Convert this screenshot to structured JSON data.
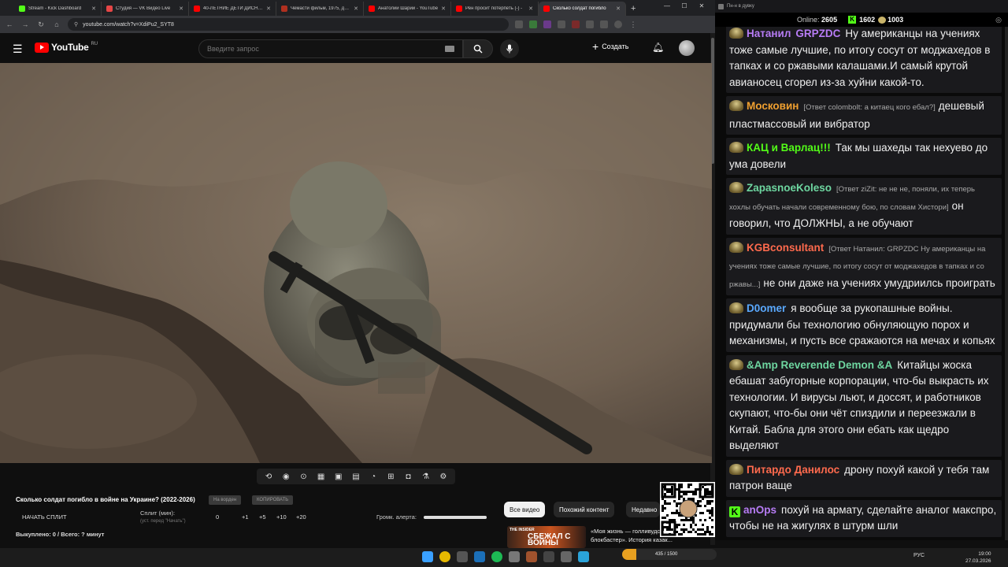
{
  "browser": {
    "tabs": [
      {
        "title": "Stream - Kick Dashboard",
        "color": "#53fc18"
      },
      {
        "title": "Студия — VK Видео Live",
        "color": "#e64646"
      },
      {
        "title": "40-ЛЕТНИЕ ДЕТИ ДИСНЕЯ",
        "color": "#ff0000"
      },
      {
        "title": "Чемасти фильм, 1975, дата",
        "color": "#b0301f"
      },
      {
        "title": "Анатолий Шарий - YouTube",
        "color": "#ff0000"
      },
      {
        "title": "Рен просит потерпеть (-) -",
        "color": "#ff0000"
      },
      {
        "title": "Сколько солдат погибло",
        "color": "#ff0000"
      }
    ],
    "new_tab": "+",
    "url": "youtube.com/watch?v=XdiPu2_SYT8"
  },
  "youtube": {
    "logo_text": "YouTube",
    "region": "RU",
    "search_placeholder": "Введите запрос",
    "create_label": "Создать",
    "video_title": "Сколько солдат погибло в войне на Украине? (2022-2026)",
    "chip_1": "На ворден",
    "chip_2": "КОПИРОВАТЬ",
    "split_button": "НАЧАТЬ СПЛИТ",
    "split_label": "Сплит (мин):",
    "split_sub": "(уст. перед \"Начать\")",
    "split_values": [
      "0",
      "+1",
      "+5",
      "+10",
      "+20"
    ],
    "alert_label": "Громк. алерта:",
    "alert_volume": 1.0,
    "footer_stat": "Выкуплено: 0 / Всего: ? минут",
    "filter_chips": [
      "Все видео",
      "Похожий контент",
      "Недавно"
    ],
    "rec_thumb_top": "THE INSIDER",
    "rec_thumb_text": "СБЕЖАЛ С ВОЙНЫ",
    "rec_title": "«Моя жизнь — голливудский блокбастер». История казак..."
  },
  "chat": {
    "header": "Пн-н в дувку",
    "online_label": "Online:",
    "online_count": "2605",
    "kick_count": "1602",
    "other_count": "1003",
    "messages": [
      {
        "nick": "Натанил",
        "nick2": "GRPZDC",
        "nick_color": "#b77cf5",
        "text": "Ну американцы на учениях тоже самые лучшие, по итогу сосут от моджахедов в тапках и со ржавыми калашами.И самый крутой авианосец сгорел из-за хуйни какой-то.",
        "reply": "",
        "badge": "ava"
      },
      {
        "nick": "Московин",
        "nick_color": "#f0a030",
        "reply": "[Ответ colombolt: а китаец кого ебал?]",
        "text": "дешевый пластмассовый ии вибратор",
        "badge": "ava"
      },
      {
        "nick": "КАЦ и Варлац!!!",
        "nick_color": "#53fc18",
        "reply": "",
        "text": "Так мы шахеды так нехуево до ума довели",
        "badge": "ava"
      },
      {
        "nick": "ZapasnoeKoleso",
        "nick_color": "#6ed6a0",
        "reply": "[Ответ ziZit: не не не, поняли, их теперь хохлы обучать начали современному бою, по словам Хистори]",
        "text": "он говорил, что ДОЛЖНЫ, а не обучают",
        "badge": "ava"
      },
      {
        "nick": "KGBconsultant",
        "nick_color": "#ff6a4d",
        "reply": "[Ответ Натанил: GRPZDC Ну американцы на учениях тоже самые лучшие, по итогу сосут от моджахедов в тапках и со ржавы...]",
        "text": "не они даже на учениях умудриилсь проиграть",
        "badge": "ava"
      },
      {
        "nick": "D0omer",
        "nick_color": "#5aa9ff",
        "reply": "",
        "text": "я вообще за рукопашные войны. придумали бы технологию обнуляющую порох и механизмы, и пусть все сражаются на мечах и копьях",
        "badge": "ava"
      },
      {
        "nick": "&Amp Reverende Demon &A",
        "nick_color": "#6ed6a0",
        "reply": "",
        "text": "Китайцы жоска ебашат забугорные корпорации, что-бы выкрасть их технологии. И вирусы льют, и доссят, и работников скупают, что-бы они чёт спиздили и переезжали в Китай. Бабла для этого они ебать как щедро выделяют",
        "badge": "ava"
      },
      {
        "nick": "Питардо Данилос",
        "nick_color": "#ff6a4d",
        "reply": "",
        "text": "дрону похуй какой у тебя там патрон ваще",
        "badge": "ava"
      },
      {
        "nick": "anOps",
        "nick_color": "#b77cf5",
        "reply": "",
        "text": "похуй на армату, сделайте аналог макспро, чтобы не на жигулях в штурм шли",
        "badge": "kick"
      }
    ]
  },
  "taskbar": {
    "lang": "РУС",
    "time": "19:00",
    "date": "27.03.2026",
    "overlay_text": "435 / 1500"
  },
  "colors": {
    "youtube_red": "#ff0000",
    "kick_green": "#53fc18"
  }
}
